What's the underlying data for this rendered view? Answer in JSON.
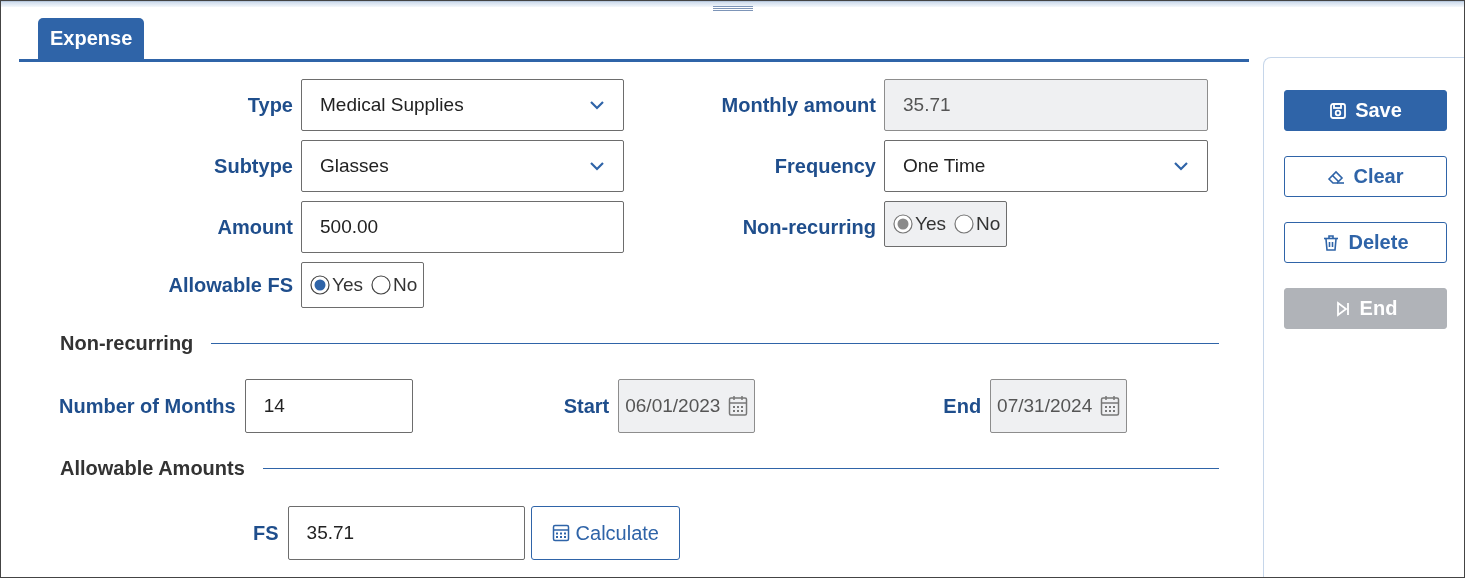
{
  "tabs": [
    {
      "label": "Expense",
      "selected": true
    }
  ],
  "form": {
    "rows": [
      {
        "left": {
          "label": "Type",
          "kind": "select",
          "value": "Medical Supplies",
          "disabled": false
        },
        "right": {
          "label": "Monthly amount",
          "kind": "text",
          "value": "35.71",
          "disabled": true
        }
      },
      {
        "left": {
          "label": "Subtype",
          "kind": "select",
          "value": "Glasses",
          "disabled": false
        },
        "right": {
          "label": "Frequency",
          "kind": "select",
          "value": "One Time",
          "disabled": false
        }
      },
      {
        "left": {
          "label": "Amount",
          "kind": "text",
          "value": "500.00",
          "disabled": false
        },
        "right": {
          "label": "Non-recurring",
          "kind": "radio",
          "disabled": true,
          "options": [
            {
              "label": "Yes",
              "selected": true
            },
            {
              "label": "No",
              "selected": false
            }
          ]
        }
      },
      {
        "left": {
          "label": "Allowable FS",
          "kind": "radio",
          "disabled": false,
          "options": [
            {
              "label": "Yes",
              "selected": true
            },
            {
              "label": "No",
              "selected": false
            }
          ]
        }
      }
    ]
  },
  "non_recurring": {
    "title": "Non-recurring",
    "fields": [
      {
        "label": "Number of Months",
        "kind": "text",
        "value": "14",
        "disabled": false
      },
      {
        "label": "Start",
        "kind": "date",
        "value": "06/01/2023",
        "disabled": true
      },
      {
        "label": "End",
        "kind": "date",
        "value": "07/31/2024",
        "disabled": true
      }
    ]
  },
  "allowable_amounts": {
    "title": "Allowable Amounts",
    "fields": [
      {
        "label": "FS",
        "kind": "text",
        "value": "35.71",
        "disabled": false
      }
    ],
    "button": {
      "label": "Calculate"
    }
  },
  "actions": [
    {
      "label": "Save",
      "kind": "primary",
      "disabled": false
    },
    {
      "label": "Clear",
      "kind": "outline",
      "disabled": false
    },
    {
      "label": "Delete",
      "kind": "outline",
      "disabled": false
    },
    {
      "label": "End",
      "kind": "outline",
      "disabled": true
    }
  ]
}
